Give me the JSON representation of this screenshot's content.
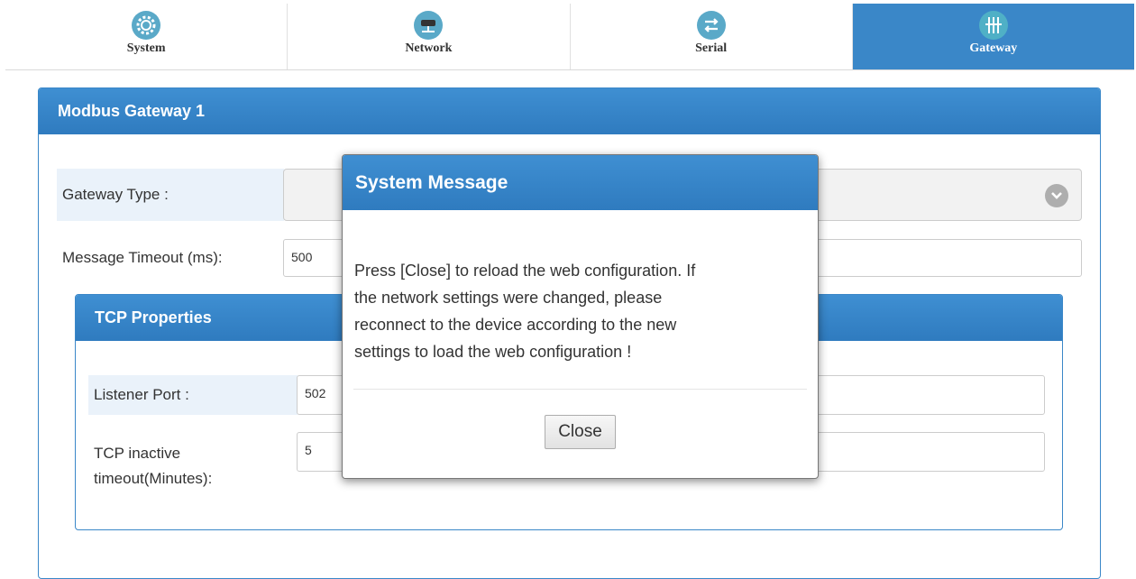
{
  "tabs": [
    {
      "label": "System",
      "icon": "gear-icon",
      "active": false
    },
    {
      "label": "Network",
      "icon": "network-icon",
      "active": false
    },
    {
      "label": "Serial",
      "icon": "serial-arrows-icon",
      "active": false
    },
    {
      "label": "Gateway",
      "icon": "gateway-icon",
      "active": true
    }
  ],
  "colors": {
    "accent": "#3a87c8",
    "tab_icon": "#5aa9c8"
  },
  "panel": {
    "title": "Modbus Gateway 1",
    "gateway_type_label": "Gateway Type :",
    "gateway_type_value": "",
    "message_timeout_label": "Message Timeout (ms):",
    "message_timeout_value": "500"
  },
  "tcp": {
    "title": "TCP Properties",
    "listener_port_label": "Listener Port :",
    "listener_port_value": "502",
    "inactive_timeout_label_line1": "TCP inactive",
    "inactive_timeout_label_line2": "timeout(Minutes):",
    "inactive_timeout_value": "5"
  },
  "modal": {
    "title": "System Message",
    "line1": "Press [Close] to reload the web configuration. If",
    "line2": "the network settings were changed, please",
    "line3": "reconnect to the device according to the new",
    "line4": "settings to load the web configuration !",
    "close_label": "Close"
  }
}
